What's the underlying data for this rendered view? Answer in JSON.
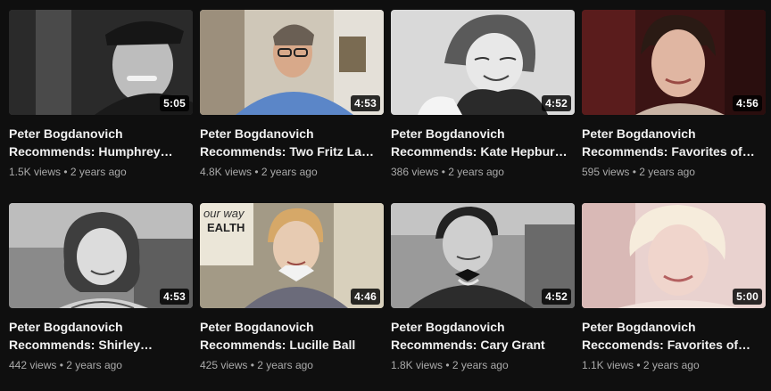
{
  "videos": [
    {
      "title_line1": "Peter Bogdanovich",
      "title_line2": "Recommends: Humphrey…",
      "duration": "5:05",
      "views": "1.5K views",
      "age": "2 years ago"
    },
    {
      "title_line1": "Peter Bogdanovich",
      "title_line2": "Recommends: Two Fritz La…",
      "duration": "4:53",
      "views": "4.8K views",
      "age": "2 years ago"
    },
    {
      "title_line1": "Peter Bogdanovich",
      "title_line2": "Recommends: Kate Hepbur…",
      "duration": "4:52",
      "views": "386 views",
      "age": "2 years ago"
    },
    {
      "title_line1": "Peter Bogdanovich",
      "title_line2": "Recommends: Favorites of…",
      "duration": "4:56",
      "views": "595 views",
      "age": "2 years ago"
    },
    {
      "title_line1": "Peter Bogdanovich",
      "title_line2": "Recommends: Shirley…",
      "duration": "4:53",
      "views": "442 views",
      "age": "2 years ago"
    },
    {
      "title_line1": "Peter Bogdanovich",
      "title_line2": "Recommends: Lucille Ball",
      "duration": "4:46",
      "views": "425 views",
      "age": "2 years ago"
    },
    {
      "title_line1": "Peter Bogdanovich",
      "title_line2": "Recommends: Cary Grant",
      "duration": "4:52",
      "views": "1.8K views",
      "age": "2 years ago"
    },
    {
      "title_line1": "Peter Bogdanovich",
      "title_line2": "Reccomends: Favorites of…",
      "duration": "5:00",
      "views": "1.1K views",
      "age": "2 years ago"
    }
  ],
  "meta_separator": "•",
  "thumb_text": {
    "poster": "our way",
    "sign": "EALTH"
  },
  "colors": {
    "background": "#0f0f0f",
    "title": "#f1f1f1",
    "meta": "#aaaaaa",
    "duration_bg": "#000000"
  }
}
